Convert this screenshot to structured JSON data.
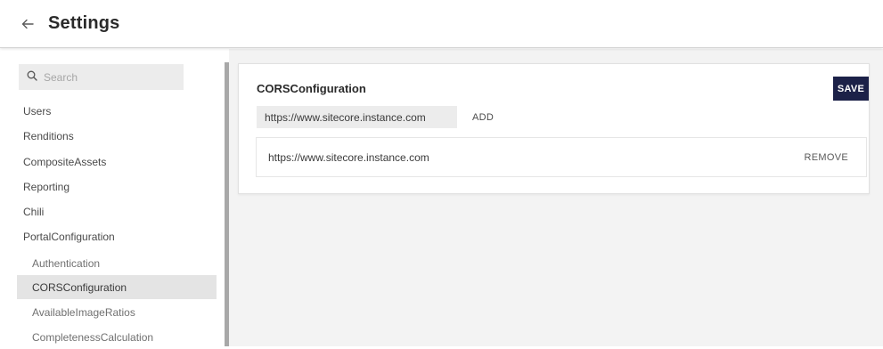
{
  "header": {
    "back_icon": "arrow-left-icon",
    "title": "Settings"
  },
  "sidebar": {
    "search": {
      "placeholder": "Search",
      "value": "",
      "icon": "search-icon"
    },
    "items": [
      {
        "label": "Users"
      },
      {
        "label": "Renditions"
      },
      {
        "label": "CompositeAssets"
      },
      {
        "label": "Reporting"
      },
      {
        "label": "Chili"
      },
      {
        "label": "PortalConfiguration"
      }
    ],
    "sub_items": [
      {
        "label": "Authentication",
        "active": false
      },
      {
        "label": "CORSConfiguration",
        "active": true
      },
      {
        "label": "AvailableImageRatios",
        "active": false
      },
      {
        "label": "CompletenessCalculation",
        "active": false
      }
    ]
  },
  "main": {
    "card": {
      "title": "CORSConfiguration",
      "save_label": "SAVE",
      "url_input_value": "https://www.sitecore.instance.com",
      "add_label": "ADD",
      "urls": [
        {
          "url": "https://www.sitecore.instance.com",
          "remove_label": "REMOVE"
        }
      ]
    }
  },
  "colors": {
    "save_button_bg": "#1c2148",
    "active_item_bg": "#e4e4e4",
    "main_bg": "#f3f3f3"
  }
}
